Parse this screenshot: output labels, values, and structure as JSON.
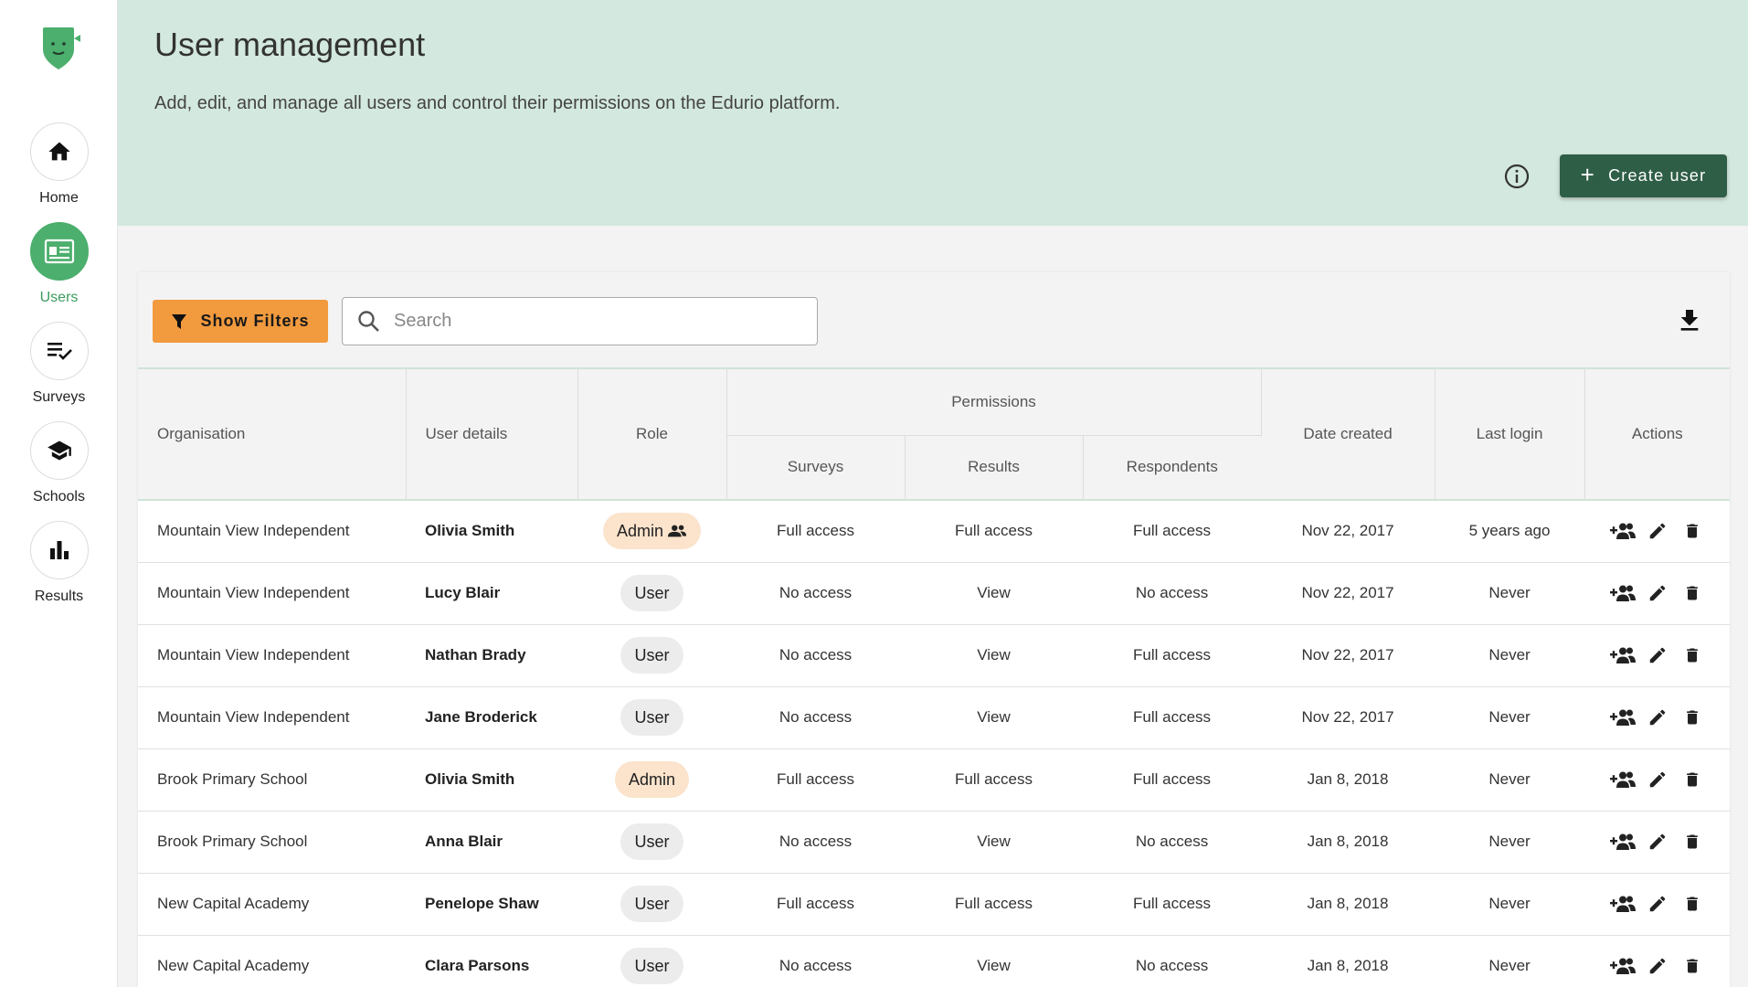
{
  "sidebar": {
    "items": [
      {
        "label": "Home",
        "icon": "home-icon",
        "active": false
      },
      {
        "label": "Users",
        "icon": "users-icon",
        "active": true
      },
      {
        "label": "Surveys",
        "icon": "surveys-icon",
        "active": false
      },
      {
        "label": "Schools",
        "icon": "schools-icon",
        "active": false
      },
      {
        "label": "Results",
        "icon": "results-icon",
        "active": false
      }
    ]
  },
  "header": {
    "title": "User management",
    "subtitle": "Add, edit, and manage all users and control their permissions on the Edurio platform.",
    "create_button": "Create user"
  },
  "toolbar": {
    "filters_button": "Show Filters",
    "search_placeholder": "Search"
  },
  "table": {
    "headers": {
      "organisation": "Organisation",
      "user_details": "User details",
      "role": "Role",
      "permissions": "Permissions",
      "surveys": "Surveys",
      "results": "Results",
      "respondents": "Respondents",
      "date_created": "Date created",
      "last_login": "Last login",
      "actions": "Actions"
    },
    "rows": [
      {
        "organisation": "Mountain View Independent",
        "name": "Olivia Smith",
        "role": "Admin",
        "role_icon": true,
        "surveys": "Full access",
        "results": "Full access",
        "respondents": "Full access",
        "date_created": "Nov 22, 2017",
        "last_login": "5 years ago"
      },
      {
        "organisation": "Mountain View Independent",
        "name": "Lucy Blair",
        "role": "User",
        "role_icon": false,
        "surveys": "No access",
        "results": "View",
        "respondents": "No access",
        "date_created": "Nov 22, 2017",
        "last_login": "Never"
      },
      {
        "organisation": "Mountain View Independent",
        "name": "Nathan Brady",
        "role": "User",
        "role_icon": false,
        "surveys": "No access",
        "results": "View",
        "respondents": "Full access",
        "date_created": "Nov 22, 2017",
        "last_login": "Never"
      },
      {
        "organisation": "Mountain View Independent",
        "name": "Jane Broderick",
        "role": "User",
        "role_icon": false,
        "surveys": "No access",
        "results": "View",
        "respondents": "Full access",
        "date_created": "Nov 22, 2017",
        "last_login": "Never"
      },
      {
        "organisation": "Brook Primary School",
        "name": "Olivia Smith",
        "role": "Admin",
        "role_icon": false,
        "surveys": "Full access",
        "results": "Full access",
        "respondents": "Full access",
        "date_created": "Jan 8, 2018",
        "last_login": "Never"
      },
      {
        "organisation": "Brook Primary School",
        "name": "Anna  Blair",
        "role": "User",
        "role_icon": false,
        "surveys": "No access",
        "results": "View",
        "respondents": "No access",
        "date_created": "Jan 8, 2018",
        "last_login": "Never"
      },
      {
        "organisation": "New Capital Academy",
        "name": "Penelope  Shaw",
        "role": "User",
        "role_icon": false,
        "surveys": "Full access",
        "results": "Full access",
        "respondents": "Full access",
        "date_created": "Jan 8, 2018",
        "last_login": "Never"
      },
      {
        "organisation": "New Capital Academy",
        "name": "Clara Parsons",
        "role": "User",
        "role_icon": false,
        "surveys": "No access",
        "results": "View",
        "respondents": "No access",
        "date_created": "Jan 8, 2018",
        "last_login": "Never"
      }
    ]
  },
  "colors": {
    "banner": "#d3e8de",
    "primary_dark": "#2f5e46",
    "accent_green": "#4caf6d",
    "filter_orange": "#f29a3e",
    "admin_badge": "#fbe3cc",
    "user_badge": "#ececec"
  }
}
